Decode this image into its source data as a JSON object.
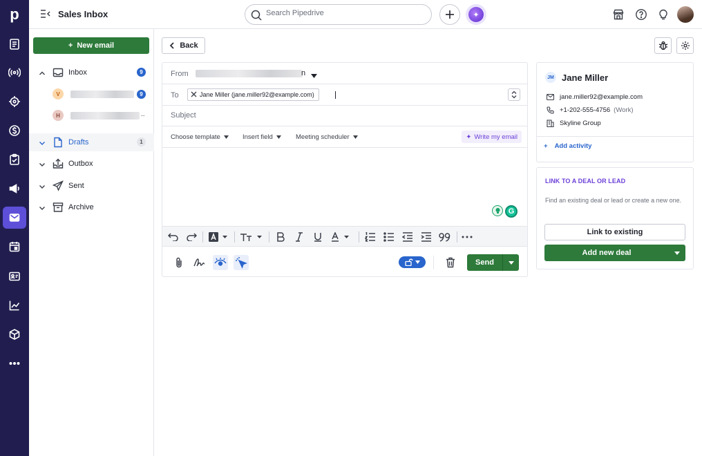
{
  "app": {
    "logo_letter": "p",
    "page_title": "Sales Inbox",
    "search_placeholder": "Search Pipedrive"
  },
  "nav": [
    {
      "name": "deals-icon"
    },
    {
      "name": "leads-icon"
    },
    {
      "name": "projects-icon"
    },
    {
      "name": "money-icon"
    },
    {
      "name": "activities-icon"
    },
    {
      "name": "campaigns-icon"
    },
    {
      "name": "mail-icon",
      "active": true
    },
    {
      "name": "calendar-icon"
    },
    {
      "name": "contacts-icon"
    },
    {
      "name": "insights-icon"
    },
    {
      "name": "products-icon"
    },
    {
      "name": "more-icon"
    }
  ],
  "sidebar": {
    "new_email_label": "New email",
    "inbox": {
      "label": "Inbox",
      "count": "9"
    },
    "accounts": [
      {
        "letter": "V",
        "count": "9",
        "color": "#fbd7a9",
        "text_color": "#c0661b"
      },
      {
        "letter": "H",
        "count": "..",
        "color": "#e9c9c2",
        "text_color": "#8a4a3e"
      }
    ],
    "folders": [
      {
        "label": "Drafts",
        "count": "1",
        "active": true
      },
      {
        "label": "Outbox"
      },
      {
        "label": "Sent"
      },
      {
        "label": "Archive"
      }
    ]
  },
  "toolbar": {
    "back_label": "Back"
  },
  "compose": {
    "from_label": "From",
    "from_value_suffix": "n",
    "to_label": "To",
    "to_recipient": "Jane Miller (jane.miller92@example.com)",
    "subject_placeholder": "Subject",
    "template_dropdown": "Choose template",
    "insert_field_dropdown": "Insert field",
    "meeting_dropdown": "Meeting scheduler",
    "write_with_ai_label": "Write my email",
    "send_label": "Send"
  },
  "contact": {
    "initials": "JM",
    "name": "Jane Miller",
    "email": "jane.miller92@example.com",
    "phone": "+1-202-555-4756",
    "phone_type": "(Work)",
    "organization": "Skyline Group",
    "add_activity_label": "Add activity"
  },
  "deal_link": {
    "title": "LINK TO A DEAL OR LEAD",
    "description": "Find an existing deal or lead or create a new one.",
    "link_existing_label": "Link to existing",
    "add_new_deal_label": "Add new deal"
  },
  "colors": {
    "sidebar_bg": "#211e4f",
    "active_nav": "#5e4fd8",
    "primary_green": "#2d7a3a",
    "link_blue": "#2965cc",
    "ai_purple": "#6c40d8"
  }
}
